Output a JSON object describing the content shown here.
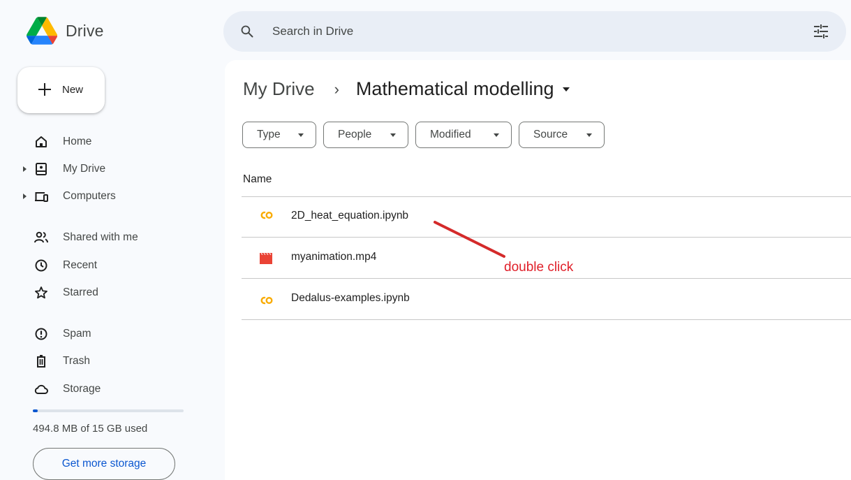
{
  "app": {
    "name": "Drive"
  },
  "search": {
    "placeholder": "Search in Drive"
  },
  "new_button": {
    "label": "New"
  },
  "sidebar": {
    "items": [
      {
        "label": "Home",
        "icon": "home-icon"
      },
      {
        "label": "My Drive",
        "icon": "my-drive-icon"
      },
      {
        "label": "Computers",
        "icon": "computers-icon"
      },
      {
        "label": "Shared with me",
        "icon": "shared-icon"
      },
      {
        "label": "Recent",
        "icon": "clock-icon"
      },
      {
        "label": "Starred",
        "icon": "star-icon"
      },
      {
        "label": "Spam",
        "icon": "spam-icon"
      },
      {
        "label": "Trash",
        "icon": "trash-icon"
      },
      {
        "label": "Storage",
        "icon": "cloud-icon"
      }
    ]
  },
  "storage": {
    "used_text": "494.8 MB of 15 GB used",
    "used_fraction": 0.033,
    "button_label": "Get more storage"
  },
  "breadcrumb": {
    "root": "My Drive",
    "separator": "›",
    "current": "Mathematical modelling"
  },
  "filters": [
    "Type",
    "People",
    "Modified",
    "Source"
  ],
  "file_list": {
    "column_header": "Name",
    "files": [
      {
        "name": "2D_heat_equation.ipynb",
        "icon": "colab-icon"
      },
      {
        "name": "myanimation.mp4",
        "icon": "video-icon"
      },
      {
        "name": "Dedalus-examples.ipynb",
        "icon": "colab-icon"
      }
    ]
  },
  "annotation": {
    "text": "double click",
    "color": "#e0202a"
  },
  "colors": {
    "accent": "#0b57d0",
    "search_bg": "#e9eef6",
    "colab": "#f9ab00",
    "video": "#ea4335"
  }
}
